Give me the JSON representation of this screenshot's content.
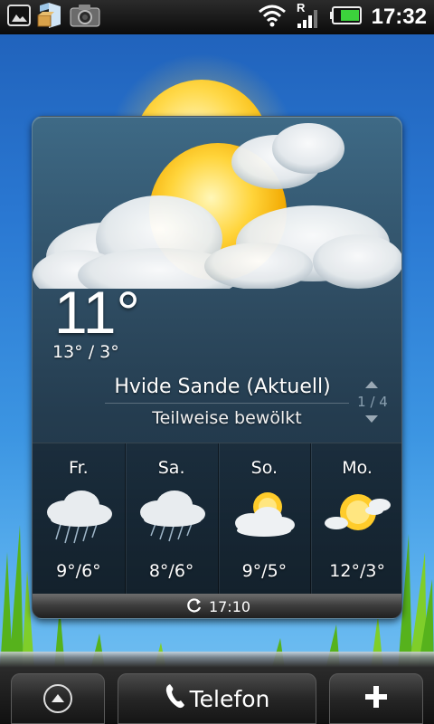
{
  "status_bar": {
    "time": "17:32",
    "roaming_indicator": "R",
    "icons": [
      "gallery-notification-icon",
      "package-notification-icon",
      "camera-notification-icon",
      "wifi-icon",
      "signal-icon",
      "battery-icon"
    ],
    "battery_color": "#3cd23c"
  },
  "weather": {
    "current_temp": "11°",
    "high_low": "13° / 3°",
    "location": "Hvide Sande (Aktuell)",
    "condition": "Teilweise bewölkt",
    "page_indicator": "1 / 4",
    "current_icon": "partly-cloudy-icon",
    "forecast": [
      {
        "day": "Fr.",
        "temp": "9°/6°",
        "icon": "rain-cloud-icon"
      },
      {
        "day": "Sa.",
        "temp": "8°/6°",
        "icon": "rain-cloud-icon"
      },
      {
        "day": "So.",
        "temp": "9°/5°",
        "icon": "partly-cloudy-icon"
      },
      {
        "day": "Mo.",
        "temp": "12°/3°",
        "icon": "sun-cloud-icon"
      }
    ],
    "last_update": "17:10"
  },
  "dock": {
    "phone_label": "Telefon"
  }
}
